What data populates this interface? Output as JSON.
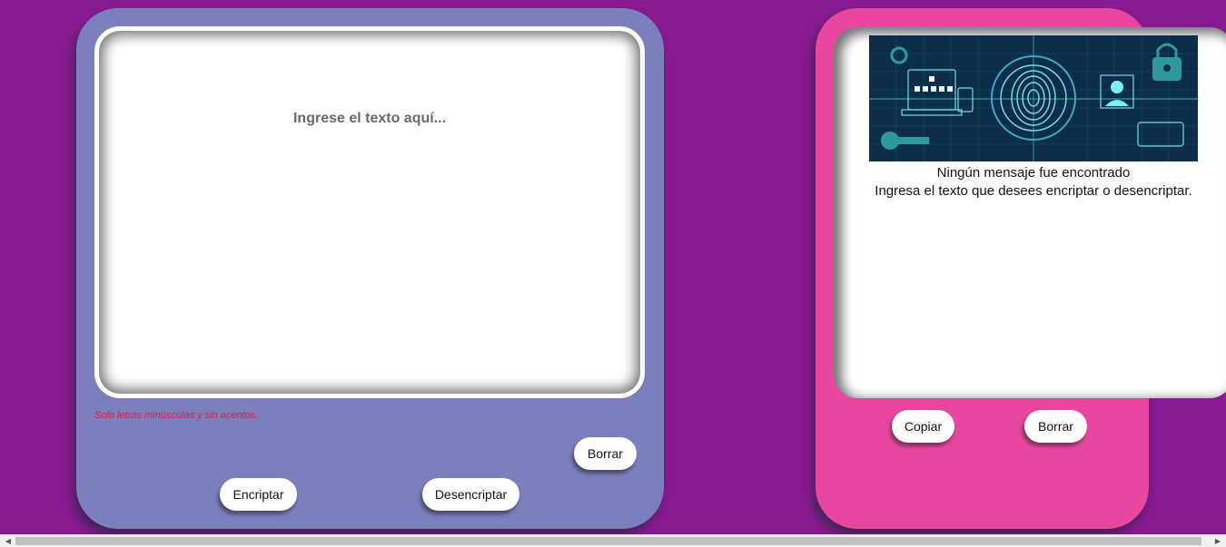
{
  "input": {
    "placeholder": "Ingrese el texto aquí...",
    "hint": "Solo letras minúsculas y sin acentos."
  },
  "buttons": {
    "clear_input": "Borrar",
    "encrypt": "Encriptar",
    "decrypt": "Desencriptar",
    "copy": "Copiar",
    "clear_output": "Borrar"
  },
  "output": {
    "illustration_icon": "cybersecurity-fingerprint-illustration",
    "empty_title": "Ningún mensaje fue encontrado",
    "empty_subtitle": "Ingresa el texto que desees encriptar o desencriptar."
  },
  "scrollbar": {
    "left_arrow": "◀",
    "right_arrow": "▶"
  },
  "colors": {
    "background": "#871a91",
    "left_panel": "#7b7fbc",
    "right_panel": "#e9479f",
    "hint_text": "#e8174a",
    "illustration_bg": "#0d2e4a",
    "illustration_accent": "#3fd0d8"
  }
}
